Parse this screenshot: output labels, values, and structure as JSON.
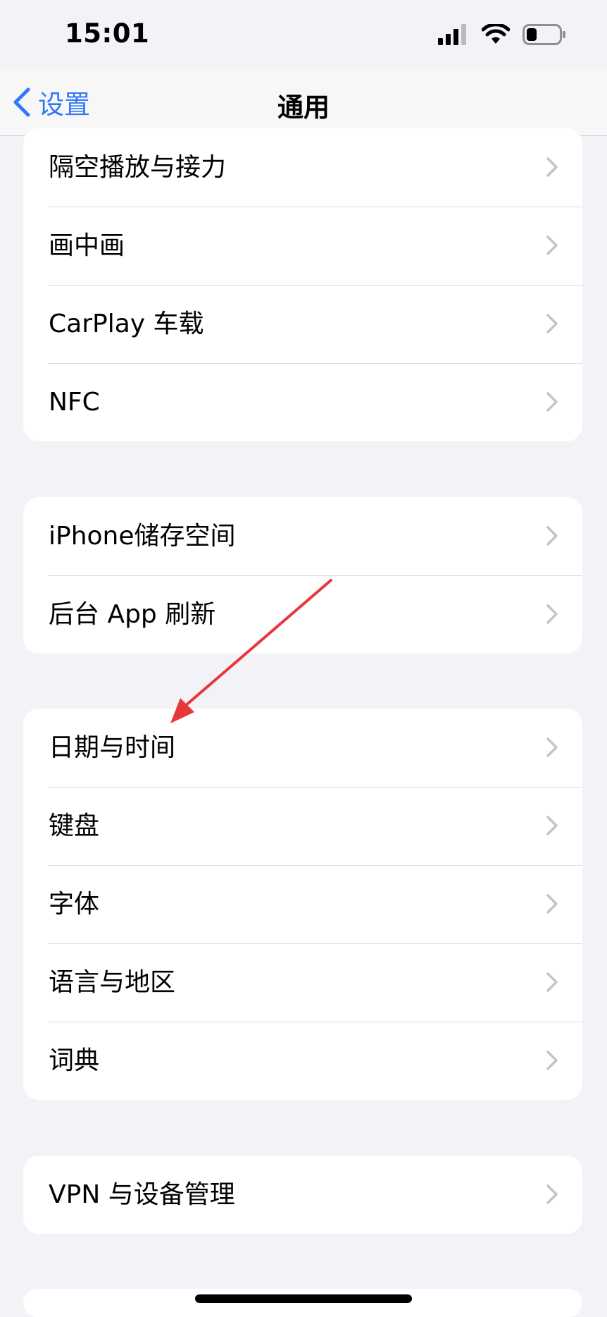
{
  "status_bar": {
    "time": "15:01"
  },
  "nav": {
    "back_label": "设置",
    "title": "通用"
  },
  "groups": [
    {
      "items": [
        "隔空播放与接力",
        "画中画",
        "CarPlay 车载",
        "NFC"
      ]
    },
    {
      "items": [
        "iPhone储存空间",
        "后台 App 刷新"
      ]
    },
    {
      "items": [
        "日期与时间",
        "键盘",
        "字体",
        "语言与地区",
        "词典"
      ]
    },
    {
      "items": [
        "VPN 与设备管理"
      ]
    }
  ],
  "colors": {
    "accent": "#3478f6",
    "annotation_arrow": "#e8373a",
    "background": "#f2f2f7"
  }
}
